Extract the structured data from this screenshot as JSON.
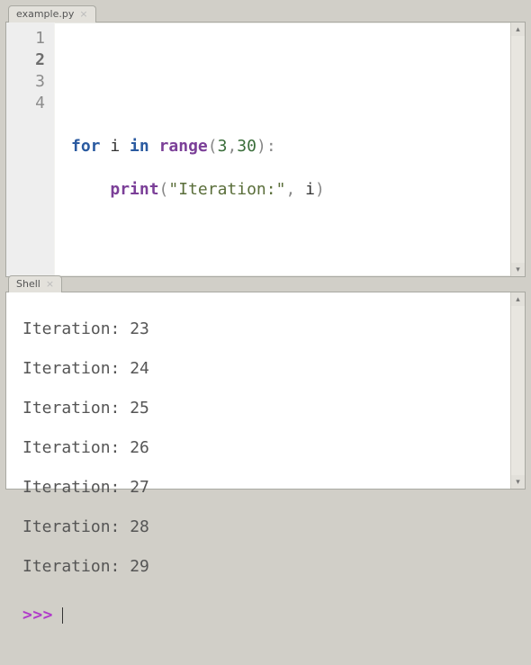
{
  "editor": {
    "tab_label": "example.py",
    "line_numbers": [
      "1",
      "2",
      "3",
      "4"
    ],
    "current_line": 2,
    "code": {
      "line3": {
        "kw_for": "for",
        "var_i": "i",
        "kw_in": "in",
        "fn_range": "range",
        "lparen": "(",
        "n1": "3",
        "comma": ",",
        "n2": "30",
        "rparen_colon": "):"
      },
      "line4": {
        "indent": "    ",
        "fn_print": "print",
        "lparen": "(",
        "str": "\"Iteration:\"",
        "comma": ",",
        "sp": " ",
        "var_i": "i",
        "rparen": ")"
      }
    }
  },
  "shell": {
    "tab_label": "Shell",
    "output": [
      "Iteration: 23",
      "Iteration: 24",
      "Iteration: 25",
      "Iteration: 26",
      "Iteration: 27",
      "Iteration: 28",
      "Iteration: 29"
    ],
    "prompt": ">>>"
  }
}
